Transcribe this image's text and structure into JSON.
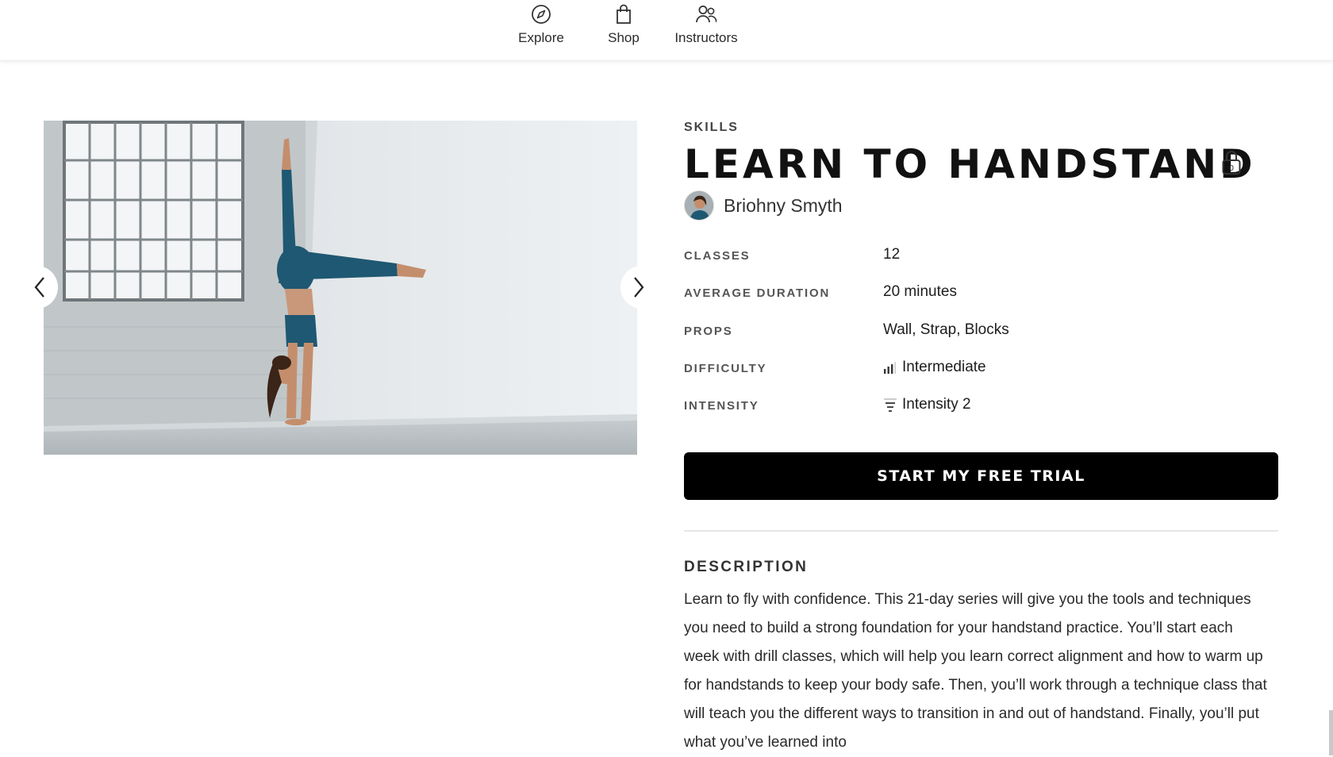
{
  "nav": {
    "items": [
      {
        "label": "Explore",
        "icon": "compass-icon"
      },
      {
        "label": "Shop",
        "icon": "shopping-bag-icon"
      },
      {
        "label": "Instructors",
        "icon": "people-icon"
      }
    ]
  },
  "program": {
    "category": "SKILLS",
    "title": "LEARN TO HANDSTAND",
    "lock_count": "0",
    "instructor": "Briohny Smyth",
    "specs": [
      {
        "label": "CLASSES",
        "value": "12"
      },
      {
        "label": "AVERAGE DURATION",
        "value": "20 minutes"
      },
      {
        "label": "PROPS",
        "value": "Wall, Strap, Blocks"
      },
      {
        "label": "DIFFICULTY",
        "value": "Intermediate",
        "icon": "difficulty-bars-icon"
      },
      {
        "label": "INTENSITY",
        "value": "Intensity 2",
        "icon": "intensity-icon"
      }
    ],
    "cta_label": "START MY FREE TRIAL",
    "description_heading": "DESCRIPTION",
    "description": "Learn to fly with confidence. This 21-day series will give you the tools and techniques you need to build a strong foundation for your handstand practice. You’ll start each week with drill classes, which will help you learn correct alignment and how to warm up for handstands to keep your body safe. Then, you’ll work through a technique class that will teach you the different ways to transition in and out of handstand. Finally, you’ll put what you’ve learned into"
  },
  "colors": {
    "cta_background": "#000000",
    "outfit": "#1f5872",
    "text": "#1a1a1a"
  }
}
